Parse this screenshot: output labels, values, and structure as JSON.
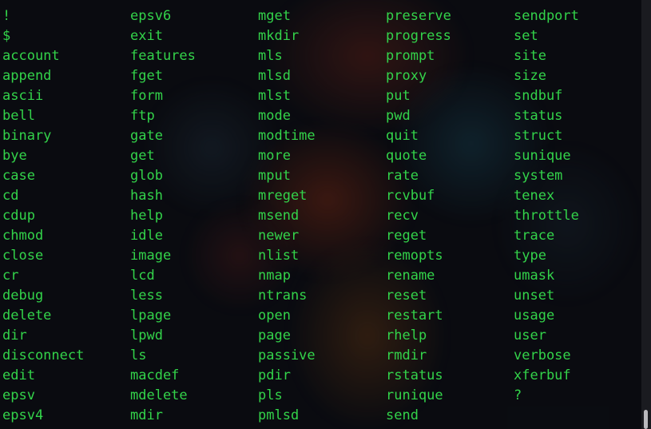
{
  "terminal": {
    "text_color": "#33d34a",
    "commands": [
      "!",
      "$",
      "account",
      "append",
      "ascii",
      "bell",
      "binary",
      "bye",
      "case",
      "cd",
      "cdup",
      "chmod",
      "close",
      "cr",
      "debug",
      "delete",
      "dir",
      "disconnect",
      "edit",
      "epsv",
      "epsv4",
      "epsv6",
      "exit",
      "features",
      "fget",
      "form",
      "ftp",
      "gate",
      "get",
      "glob",
      "hash",
      "help",
      "idle",
      "image",
      "lcd",
      "less",
      "lpage",
      "lpwd",
      "ls",
      "macdef",
      "mdelete",
      "mdir",
      "mget",
      "mkdir",
      "mls",
      "mlsd",
      "mlst",
      "mode",
      "modtime",
      "more",
      "mput",
      "mreget",
      "msend",
      "newer",
      "nlist",
      "nmap",
      "ntrans",
      "open",
      "page",
      "passive",
      "pdir",
      "pls",
      "pmlsd",
      "preserve",
      "progress",
      "prompt",
      "proxy",
      "put",
      "pwd",
      "quit",
      "quote",
      "rate",
      "rcvbuf",
      "recv",
      "reget",
      "remopts",
      "rename",
      "reset",
      "restart",
      "rhelp",
      "rmdir",
      "rstatus",
      "runique",
      "send",
      "sendport",
      "set",
      "site",
      "size",
      "sndbuf",
      "status",
      "struct",
      "sunique",
      "system",
      "tenex",
      "throttle",
      "trace",
      "type",
      "umask",
      "unset",
      "usage",
      "user",
      "verbose",
      "xferbuf",
      "?"
    ]
  },
  "scrollbar": {
    "position": 1.0
  }
}
